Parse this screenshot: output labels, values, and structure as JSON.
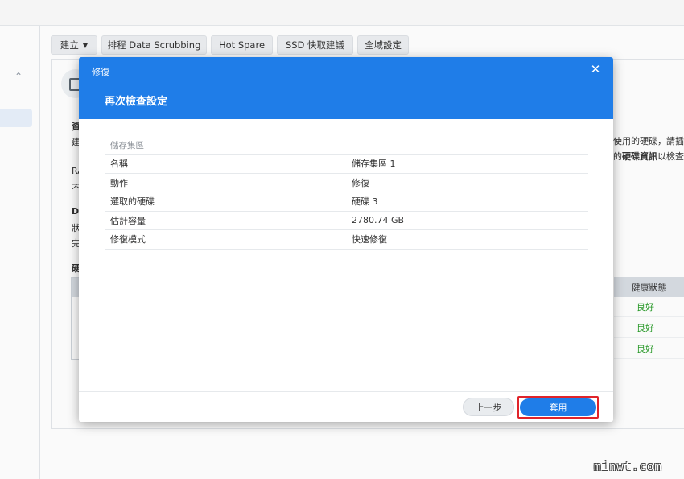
{
  "toolbar": {
    "create_label": "建立",
    "data_scrubbing_label": "排程 Data Scrubbing",
    "hot_spare_label": "Hot Spare",
    "ssd_label": "SSD 快取建議",
    "global_settings_label": "全域設定"
  },
  "background": {
    "frag_1": "資",
    "frag_2": "建",
    "frag_3": "RA",
    "frag_4": "不",
    "frag_5": "D",
    "frag_6": "狀",
    "frag_7": "完",
    "frag_8": "硬",
    "right_text_1": "使用的硬碟，請插入",
    "right_text_2_prefix": "的",
    "right_text_2_bold": "硬碟資訊",
    "right_text_2_suffix": "以檢查",
    "health_header": "健康狀態",
    "health_values": [
      "良好",
      "良好",
      "良好"
    ]
  },
  "dialog": {
    "title": "修復",
    "heading": "再次檢查設定",
    "section_label": "儲存集區",
    "rows": [
      {
        "key": "名稱",
        "value": "儲存集區 1"
      },
      {
        "key": "動作",
        "value": "修復"
      },
      {
        "key": "選取的硬碟",
        "value": "硬碟 3"
      },
      {
        "key": "估計容量",
        "value": "2780.74 GB"
      },
      {
        "key": "修復模式",
        "value": "快速修復"
      }
    ],
    "back_label": "上一步",
    "apply_label": "套用"
  },
  "watermark": "minwt.com",
  "colors": {
    "accent": "#1f7de8",
    "highlight_border": "#e0242a",
    "health_good": "#2a9d2a"
  }
}
